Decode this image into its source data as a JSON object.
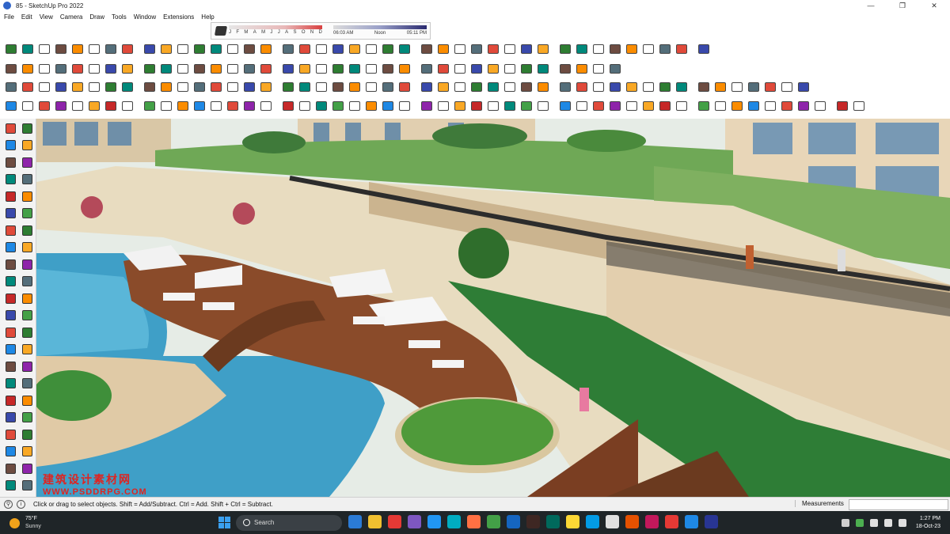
{
  "window": {
    "title": "85 - SketchUp Pro 2022",
    "controls": [
      "—",
      "❐",
      "✕"
    ]
  },
  "menu": [
    "File",
    "Edit",
    "View",
    "Camera",
    "Draw",
    "Tools",
    "Window",
    "Extensions",
    "Help"
  ],
  "shadows": {
    "months": [
      "J",
      "F",
      "M",
      "A",
      "M",
      "J",
      "J",
      "A",
      "S",
      "O",
      "N",
      "D"
    ],
    "time_start": "06:03 AM",
    "time_noon": "Noon",
    "time_end": "05:11 PM"
  },
  "toolbar_palette": [
    "#e04a3a",
    "#2e7d32",
    "#1e88e5",
    "#f9a825",
    "#6d4c41",
    "#8e24aa",
    "#00897b",
    "#546e7a",
    "#c62828",
    "#fb8c00",
    "#3949ab",
    "#43a047"
  ],
  "watermark": {
    "line1": "建筑设计素材网",
    "line2": "WWW.PSDDRPG.COM"
  },
  "status": {
    "message": "Click or drag to select objects. Shift = Add/Subtract. Ctrl = Add. Shift + Ctrl = Subtract.",
    "measurements_label": "Measurements",
    "measurements_value": ""
  },
  "taskbar": {
    "temperature": "75°F",
    "condition": "Sunny",
    "search_placeholder": "Search",
    "time": "1:27 PM",
    "date": "18-Oct-23"
  }
}
